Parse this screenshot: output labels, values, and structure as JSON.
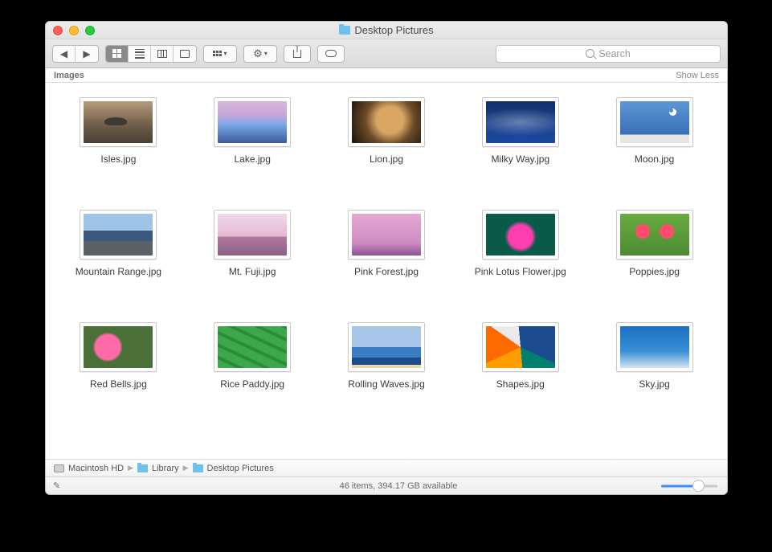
{
  "window": {
    "title": "Desktop Pictures"
  },
  "toolbar": {
    "nav_back": "‹",
    "nav_fwd": "›"
  },
  "search": {
    "placeholder": "Search"
  },
  "section": {
    "label": "Images",
    "toggle": "Show Less"
  },
  "items": [
    {
      "name": "Isles.jpg",
      "class": "isles"
    },
    {
      "name": "Lake.jpg",
      "class": "lake"
    },
    {
      "name": "Lion.jpg",
      "class": "lion"
    },
    {
      "name": "Milky Way.jpg",
      "class": "milky"
    },
    {
      "name": "Moon.jpg",
      "class": "moon"
    },
    {
      "name": "Mountain Range.jpg",
      "class": "mountain"
    },
    {
      "name": "Mt. Fuji.jpg",
      "class": "fuji"
    },
    {
      "name": "Pink Forest.jpg",
      "class": "pinkf"
    },
    {
      "name": "Pink Lotus Flower.jpg",
      "class": "lotus"
    },
    {
      "name": "Poppies.jpg",
      "class": "poppies"
    },
    {
      "name": "Red Bells.jpg",
      "class": "redbells"
    },
    {
      "name": "Rice Paddy.jpg",
      "class": "rice"
    },
    {
      "name": "Rolling Waves.jpg",
      "class": "waves"
    },
    {
      "name": "Shapes.jpg",
      "class": "shapes"
    },
    {
      "name": "Sky.jpg",
      "class": "sky"
    }
  ],
  "path": {
    "seg1": "Macintosh HD",
    "seg2": "Library",
    "seg3": "Desktop Pictures"
  },
  "status": {
    "text": "46 items, 394.17 GB available"
  }
}
